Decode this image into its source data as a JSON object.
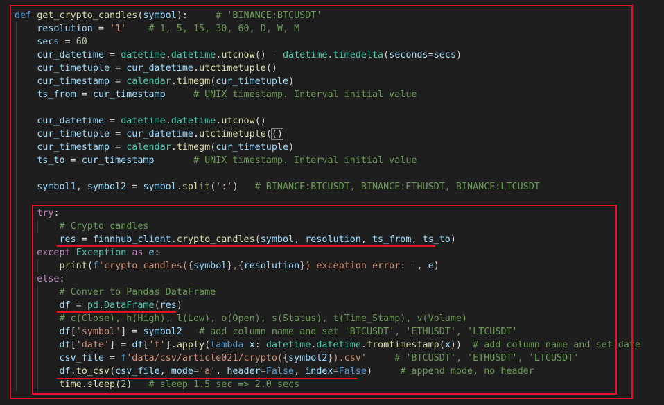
{
  "editor": {
    "lines": [
      [
        [
          "kw",
          "def"
        ],
        [
          "plain",
          " "
        ],
        [
          "fn",
          "get_crypto_candles"
        ],
        [
          "plain",
          "("
        ],
        [
          "var",
          "symbol"
        ],
        [
          "plain",
          "):     "
        ],
        [
          "cmt",
          "# 'BINANCE:BTCUSDT'"
        ]
      ],
      [
        [
          "plain",
          "    "
        ],
        [
          "var",
          "resolution"
        ],
        [
          "plain",
          " = "
        ],
        [
          "str",
          "'1'"
        ],
        [
          "plain",
          "    "
        ],
        [
          "cmt",
          "# 1, 5, 15, 30, 60, D, W, M"
        ]
      ],
      [
        [
          "plain",
          "    "
        ],
        [
          "var",
          "secs"
        ],
        [
          "plain",
          " = "
        ],
        [
          "num",
          "60"
        ]
      ],
      [
        [
          "plain",
          "    "
        ],
        [
          "var",
          "cur_datetime"
        ],
        [
          "plain",
          " = "
        ],
        [
          "cls",
          "datetime"
        ],
        [
          "plain",
          "."
        ],
        [
          "cls",
          "datetime"
        ],
        [
          "plain",
          "."
        ],
        [
          "fn",
          "utcnow"
        ],
        [
          "plain",
          "() - "
        ],
        [
          "cls",
          "datetime"
        ],
        [
          "plain",
          "."
        ],
        [
          "cls",
          "timedelta"
        ],
        [
          "plain",
          "("
        ],
        [
          "var",
          "seconds"
        ],
        [
          "plain",
          "="
        ],
        [
          "var",
          "secs"
        ],
        [
          "plain",
          ")"
        ]
      ],
      [
        [
          "plain",
          "    "
        ],
        [
          "var",
          "cur_timetuple"
        ],
        [
          "plain",
          " = "
        ],
        [
          "var",
          "cur_datetime"
        ],
        [
          "plain",
          "."
        ],
        [
          "fn",
          "utctimetuple"
        ],
        [
          "plain",
          "()"
        ]
      ],
      [
        [
          "plain",
          "    "
        ],
        [
          "var",
          "cur_timestamp"
        ],
        [
          "plain",
          " = "
        ],
        [
          "cls",
          "calendar"
        ],
        [
          "plain",
          "."
        ],
        [
          "fn",
          "timegm"
        ],
        [
          "plain",
          "("
        ],
        [
          "var",
          "cur_timetuple"
        ],
        [
          "plain",
          ")"
        ]
      ],
      [
        [
          "plain",
          "    "
        ],
        [
          "var",
          "ts_from"
        ],
        [
          "plain",
          " = "
        ],
        [
          "var",
          "cur_timestamp"
        ],
        [
          "plain",
          "     "
        ],
        [
          "cmt",
          "# UNIX timestamp. Interval initial value"
        ]
      ],
      [],
      [
        [
          "plain",
          "    "
        ],
        [
          "var",
          "cur_datetime"
        ],
        [
          "plain",
          " = "
        ],
        [
          "cls",
          "datetime"
        ],
        [
          "plain",
          "."
        ],
        [
          "cls",
          "datetime"
        ],
        [
          "plain",
          "."
        ],
        [
          "fn",
          "utcnow"
        ],
        [
          "plain",
          "()"
        ]
      ],
      [
        [
          "plain",
          "    "
        ],
        [
          "var",
          "cur_timetuple"
        ],
        [
          "plain",
          " = "
        ],
        [
          "var",
          "cur_datetime"
        ],
        [
          "plain",
          "."
        ],
        [
          "fn",
          "utctimetuple"
        ],
        [
          "plain",
          "("
        ],
        [
          "bm",
          "()"
        ]
      ],
      [
        [
          "plain",
          "    "
        ],
        [
          "var",
          "cur_timestamp"
        ],
        [
          "plain",
          " = "
        ],
        [
          "cls",
          "calendar"
        ],
        [
          "plain",
          "."
        ],
        [
          "fn",
          "timegm"
        ],
        [
          "plain",
          "("
        ],
        [
          "var",
          "cur_timetuple"
        ],
        [
          "plain",
          ")"
        ]
      ],
      [
        [
          "plain",
          "    "
        ],
        [
          "var",
          "ts_to"
        ],
        [
          "plain",
          " = "
        ],
        [
          "var",
          "cur_timestamp"
        ],
        [
          "plain",
          "       "
        ],
        [
          "cmt",
          "# UNIX timestamp. Interval initial value"
        ]
      ],
      [],
      [
        [
          "plain",
          "    "
        ],
        [
          "var",
          "symbol1"
        ],
        [
          "plain",
          ", "
        ],
        [
          "var",
          "symbol2"
        ],
        [
          "plain",
          " = "
        ],
        [
          "var",
          "symbol"
        ],
        [
          "plain",
          "."
        ],
        [
          "fn",
          "split"
        ],
        [
          "plain",
          "("
        ],
        [
          "str",
          "':'"
        ],
        [
          "plain",
          ")   "
        ],
        [
          "cmt",
          "# BINANCE:BTCUSDT, BINANCE:ETHUSDT, BINANCE:LTCUSDT"
        ]
      ],
      [],
      [
        [
          "plain",
          "    "
        ],
        [
          "ctl",
          "try"
        ],
        [
          "plain",
          ":"
        ]
      ],
      [
        [
          "plain",
          "        "
        ],
        [
          "cmt",
          "# Crypto candles"
        ]
      ],
      [
        [
          "plain",
          "        "
        ],
        [
          "var",
          "res"
        ],
        [
          "plain",
          " = "
        ],
        [
          "var",
          "finnhub_client"
        ],
        [
          "plain",
          "."
        ],
        [
          "fn",
          "crypto_candles"
        ],
        [
          "plain",
          "("
        ],
        [
          "var",
          "symbol"
        ],
        [
          "plain",
          ", "
        ],
        [
          "var",
          "resolution"
        ],
        [
          "plain",
          ", "
        ],
        [
          "var",
          "ts_from"
        ],
        [
          "plain",
          ", "
        ],
        [
          "var",
          "ts_to"
        ],
        [
          "plain",
          ")"
        ]
      ],
      [
        [
          "plain",
          "    "
        ],
        [
          "ctl",
          "except"
        ],
        [
          "plain",
          " "
        ],
        [
          "cls",
          "Exception"
        ],
        [
          "plain",
          " "
        ],
        [
          "ctl",
          "as"
        ],
        [
          "plain",
          " "
        ],
        [
          "var",
          "e"
        ],
        [
          "plain",
          ":"
        ]
      ],
      [
        [
          "plain",
          "        "
        ],
        [
          "fn",
          "print"
        ],
        [
          "plain",
          "("
        ],
        [
          "kw",
          "f"
        ],
        [
          "str",
          "'crypto_candles("
        ],
        [
          "plain",
          "{"
        ],
        [
          "var",
          "symbol"
        ],
        [
          "plain",
          "}"
        ],
        [
          "str",
          ","
        ],
        [
          "plain",
          "{"
        ],
        [
          "var",
          "resolution"
        ],
        [
          "plain",
          "}"
        ],
        [
          "str",
          ") exception error: '"
        ],
        [
          "plain",
          ", "
        ],
        [
          "var",
          "e"
        ],
        [
          "plain",
          ")"
        ]
      ],
      [
        [
          "plain",
          "    "
        ],
        [
          "ctl",
          "else"
        ],
        [
          "plain",
          ":"
        ]
      ],
      [
        [
          "plain",
          "        "
        ],
        [
          "cmt",
          "# Conver to Pandas DataFrame"
        ]
      ],
      [
        [
          "plain",
          "        "
        ],
        [
          "var",
          "df"
        ],
        [
          "plain",
          " = "
        ],
        [
          "cls",
          "pd"
        ],
        [
          "plain",
          "."
        ],
        [
          "cls",
          "DataFrame"
        ],
        [
          "plain",
          "("
        ],
        [
          "var",
          "res"
        ],
        [
          "plain",
          ")"
        ]
      ],
      [
        [
          "plain",
          "        "
        ],
        [
          "cmt",
          "# c(Close), h(High), l(Low), o(Open), s(Status), t(Time_Stamp), v(Volume)"
        ]
      ],
      [
        [
          "plain",
          "        "
        ],
        [
          "var",
          "df"
        ],
        [
          "plain",
          "["
        ],
        [
          "str",
          "'symbol'"
        ],
        [
          "plain",
          "] = "
        ],
        [
          "var",
          "symbol2"
        ],
        [
          "plain",
          "   "
        ],
        [
          "cmt",
          "# add column name and set 'BTCUSDT', 'ETHUSDT', 'LTCUSDT'"
        ]
      ],
      [
        [
          "plain",
          "        "
        ],
        [
          "var",
          "df"
        ],
        [
          "plain",
          "["
        ],
        [
          "str",
          "'date'"
        ],
        [
          "plain",
          "] = "
        ],
        [
          "var",
          "df"
        ],
        [
          "plain",
          "["
        ],
        [
          "str",
          "'t'"
        ],
        [
          "plain",
          "]."
        ],
        [
          "fn",
          "apply"
        ],
        [
          "plain",
          "("
        ],
        [
          "kw",
          "lambda"
        ],
        [
          "plain",
          " "
        ],
        [
          "var",
          "x"
        ],
        [
          "plain",
          ": "
        ],
        [
          "cls",
          "datetime"
        ],
        [
          "plain",
          "."
        ],
        [
          "cls",
          "datetime"
        ],
        [
          "plain",
          "."
        ],
        [
          "fn",
          "fromtimestamp"
        ],
        [
          "plain",
          "("
        ],
        [
          "var",
          "x"
        ],
        [
          "plain",
          "))  "
        ],
        [
          "cmt",
          "# add column name and set date"
        ]
      ],
      [
        [
          "plain",
          "        "
        ],
        [
          "var",
          "csv_file"
        ],
        [
          "plain",
          " = "
        ],
        [
          "kw",
          "f"
        ],
        [
          "str",
          "'data/csv/article021/crypto("
        ],
        [
          "plain",
          "{"
        ],
        [
          "var",
          "symbol2"
        ],
        [
          "plain",
          "}"
        ],
        [
          "str",
          ").csv'"
        ],
        [
          "plain",
          "     "
        ],
        [
          "cmt",
          "# 'BTCUSDT', 'ETHUSDT', 'LTCUSDT'"
        ]
      ],
      [
        [
          "plain",
          "        "
        ],
        [
          "var",
          "df"
        ],
        [
          "plain",
          "."
        ],
        [
          "fn",
          "to_csv"
        ],
        [
          "plain",
          "("
        ],
        [
          "var",
          "csv_file"
        ],
        [
          "plain",
          ", "
        ],
        [
          "var",
          "mode"
        ],
        [
          "plain",
          "="
        ],
        [
          "str",
          "'a'"
        ],
        [
          "plain",
          ", "
        ],
        [
          "var",
          "header"
        ],
        [
          "plain",
          "="
        ],
        [
          "kw",
          "False"
        ],
        [
          "plain",
          ", "
        ],
        [
          "var",
          "index"
        ],
        [
          "plain",
          "="
        ],
        [
          "kw",
          "False"
        ],
        [
          "plain",
          ")     "
        ],
        [
          "cmt",
          "# append mode, no header"
        ]
      ],
      [
        [
          "plain",
          "        "
        ],
        [
          "fn",
          "time"
        ],
        [
          "plain",
          "."
        ],
        [
          "fn",
          "sleep"
        ],
        [
          "plain",
          "("
        ],
        [
          "num",
          "2"
        ],
        [
          "plain",
          ")   "
        ],
        [
          "cmt",
          "# sleep 1.5 sec => 2.0 secs"
        ]
      ]
    ]
  },
  "colors": {
    "background": "#1e1e1e",
    "highlight": "#e81123"
  }
}
